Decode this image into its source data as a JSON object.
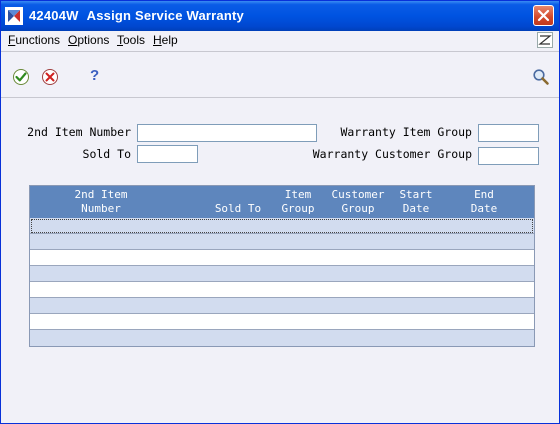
{
  "window": {
    "title_code": "42404W",
    "title_name": "Assign Service Warranty"
  },
  "menu": {
    "items": [
      {
        "label": "Functions",
        "mnemonic": "F",
        "rest": "unctions"
      },
      {
        "label": "Options",
        "mnemonic": "O",
        "rest": "ptions"
      },
      {
        "label": "Tools",
        "mnemonic": "T",
        "rest": "ools"
      },
      {
        "label": "Help",
        "mnemonic": "H",
        "rest": "elp"
      }
    ]
  },
  "toolbar": {
    "ok_icon": "checkmark-icon",
    "cancel_icon": "cancel-icon",
    "help_glyph": "?",
    "search_icon": "magnifier-icon"
  },
  "form": {
    "second_item_number_label": "2nd Item Number",
    "second_item_number_value": "",
    "sold_to_label": "Sold To",
    "sold_to_value": "",
    "warranty_item_group_label": "Warranty Item Group",
    "warranty_item_group_value": "",
    "warranty_customer_group_label": "Warranty Customer Group",
    "warranty_customer_group_value": ""
  },
  "grid": {
    "columns": [
      {
        "line1": "2nd Item",
        "line2": "Number"
      },
      {
        "line1": "",
        "line2": "Sold To"
      },
      {
        "line1": "Item",
        "line2": "Group"
      },
      {
        "line1": "Customer",
        "line2": "Group"
      },
      {
        "line1": "Start",
        "line2": "Date"
      },
      {
        "line1": "End",
        "line2": "Date"
      }
    ],
    "row_count": 8
  },
  "colors": {
    "title_bar": "#0053e1",
    "grid_header": "#5e86bd",
    "row_alt": "#d2dcef",
    "window_bg": "#f1f1f8"
  }
}
